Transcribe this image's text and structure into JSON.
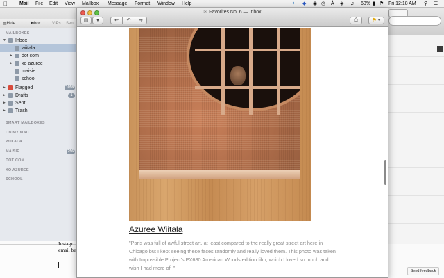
{
  "menubar": {
    "apple_icon": "apple-icon",
    "app": "Mail",
    "items": [
      "File",
      "Edit",
      "View",
      "Mailbox",
      "Message",
      "Format",
      "Window",
      "Help"
    ],
    "battery": "63%",
    "clock": "Fri 12:18 AM"
  },
  "sidebar": {
    "hide": "Hide",
    "inbox_dropdown": "Inbox",
    "vips": "VIPs",
    "sent": "Sent",
    "section_mailboxes": "MAILBOXES",
    "rows": [
      {
        "label": "Inbox",
        "level": 0
      },
      {
        "label": "wiitala",
        "level": 1
      },
      {
        "label": "dot com",
        "level": 1
      },
      {
        "label": "xo azuree",
        "level": 1
      },
      {
        "label": "maisie",
        "level": 1
      },
      {
        "label": "school",
        "level": 1
      },
      {
        "label": "Flagged",
        "level": 0,
        "badge": "1058"
      },
      {
        "label": "Drafts",
        "level": 0,
        "badge": "1"
      },
      {
        "label": "Sent",
        "level": 0
      },
      {
        "label": "Trash",
        "level": 0
      }
    ],
    "sections": [
      {
        "label": "SMART MAILBOXES"
      },
      {
        "label": "ON MY MAC"
      },
      {
        "label": "WIITALA"
      },
      {
        "label": "MAISIE",
        "badge": "256"
      },
      {
        "label": "DOT COM"
      },
      {
        "label": "XO AZUREE"
      },
      {
        "label": "SCHOOL"
      }
    ],
    "bottom_add": "+",
    "bottom_activity": "⏏",
    "bottom_gear": "⚙"
  },
  "compose": {
    "line1": "Instagr",
    "line2": "email be"
  },
  "message_window": {
    "title": "Favorites No. 6 — Inbox",
    "toolbar": {
      "delete_icon": "trash-icon",
      "junk_icon": "thumbs-down-icon",
      "reply_icon": "reply-icon",
      "reply_all_icon": "reply-all-icon",
      "forward_icon": "forward-icon",
      "print_icon": "print-icon",
      "flag_icon": "flag-icon"
    },
    "caption_title": "Azuree Wiitala",
    "caption_text": "\"Paris was full of awful street art, at least compared to the really great street art here in Chicago but I kept seeing these faces randomly and really loved them. This photo was taken with Impossible Project's PX680 American Woods edition film, which I loved so much and wish I had more of! \""
  },
  "send_feedback": "Send feedback"
}
